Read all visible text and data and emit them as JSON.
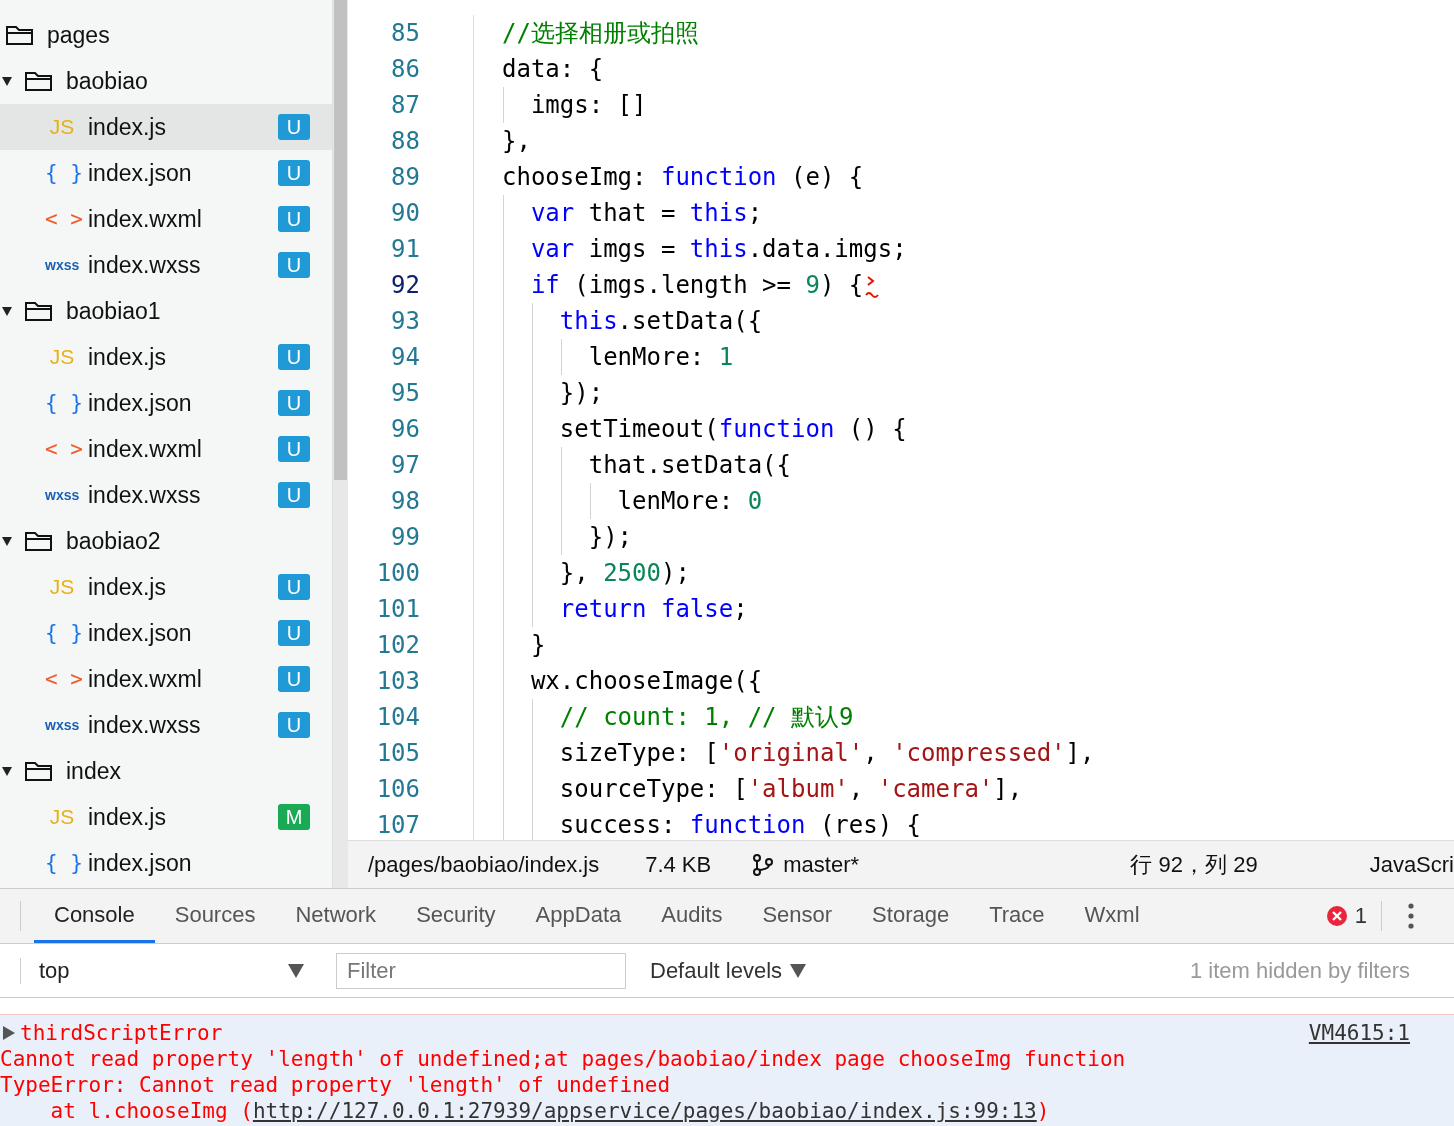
{
  "sidebar": {
    "tree": [
      {
        "name": "pages",
        "kind": "folder",
        "children": [
          {
            "name": "baobiao",
            "kind": "folder",
            "expanded": true,
            "children": [
              {
                "name": "index.js",
                "kind": "js",
                "icon": "JS",
                "badge": "U",
                "color": "#1f9ad6",
                "selected": true
              },
              {
                "name": "index.json",
                "kind": "json",
                "icon": "{ }",
                "badge": "U",
                "color": "#1f9ad6",
                "selected": false
              },
              {
                "name": "index.wxml",
                "kind": "wxml",
                "icon": "< >",
                "badge": "U",
                "color": "#1f9ad6",
                "selected": false
              },
              {
                "name": "index.wxss",
                "kind": "wxss",
                "icon": "wxss",
                "badge": "U",
                "color": "#1f9ad6",
                "selected": false
              }
            ]
          },
          {
            "name": "baobiao1",
            "kind": "folder",
            "expanded": true,
            "children": [
              {
                "name": "index.js",
                "kind": "js",
                "icon": "JS",
                "badge": "U",
                "color": "#1f9ad6",
                "selected": false
              },
              {
                "name": "index.json",
                "kind": "json",
                "icon": "{ }",
                "badge": "U",
                "color": "#1f9ad6",
                "selected": false
              },
              {
                "name": "index.wxml",
                "kind": "wxml",
                "icon": "< >",
                "badge": "U",
                "color": "#1f9ad6",
                "selected": false
              },
              {
                "name": "index.wxss",
                "kind": "wxss",
                "icon": "wxss",
                "badge": "U",
                "color": "#1f9ad6",
                "selected": false
              }
            ]
          },
          {
            "name": "baobiao2",
            "kind": "folder",
            "expanded": true,
            "children": [
              {
                "name": "index.js",
                "kind": "js",
                "icon": "JS",
                "badge": "U",
                "color": "#1f9ad6",
                "selected": false
              },
              {
                "name": "index.json",
                "kind": "json",
                "icon": "{ }",
                "badge": "U",
                "color": "#1f9ad6",
                "selected": false
              },
              {
                "name": "index.wxml",
                "kind": "wxml",
                "icon": "< >",
                "badge": "U",
                "color": "#1f9ad6",
                "selected": false
              },
              {
                "name": "index.wxss",
                "kind": "wxss",
                "icon": "wxss",
                "badge": "U",
                "color": "#1f9ad6",
                "selected": false
              }
            ]
          },
          {
            "name": "index",
            "kind": "folder",
            "expanded": true,
            "children": [
              {
                "name": "index.js",
                "kind": "js",
                "icon": "JS",
                "badge": "M",
                "color": "#1aaa55",
                "selected": false
              },
              {
                "name": "index.json",
                "kind": "json",
                "icon": "{ }",
                "selected": false
              }
            ]
          }
        ]
      }
    ]
  },
  "editor": {
    "lines": [
      {
        "number": "85",
        "current": false,
        "tokens": [
          {
            "t": "//选择相册或拍照",
            "kind": "comment"
          }
        ]
      },
      {
        "number": "86",
        "current": false,
        "tokens": [
          {
            "t": "data: {",
            "kind": "plain"
          }
        ]
      },
      {
        "number": "87",
        "current": false,
        "tokens": [
          {
            "t": "  imgs: []",
            "kind": "plain"
          }
        ]
      },
      {
        "number": "88",
        "current": false,
        "tokens": [
          {
            "t": "},",
            "kind": "plain"
          }
        ]
      },
      {
        "number": "89",
        "current": false,
        "tokens": [
          {
            "t": "chooseImg: ",
            "kind": "plain"
          },
          {
            "t": "function",
            "kind": "keyword"
          },
          {
            "t": " (e) {",
            "kind": "plain"
          }
        ]
      },
      {
        "number": "90",
        "current": false,
        "tokens": [
          {
            "t": "  var",
            "kind": "keyword"
          },
          {
            "t": " that = ",
            "kind": "plain"
          },
          {
            "t": "this",
            "kind": "keyword"
          },
          {
            "t": ";",
            "kind": "plain"
          }
        ]
      },
      {
        "number": "91",
        "current": false,
        "tokens": [
          {
            "t": "  var",
            "kind": "keyword"
          },
          {
            "t": " imgs = ",
            "kind": "plain"
          },
          {
            "t": "this",
            "kind": "keyword"
          },
          {
            "t": ".data.imgs;",
            "kind": "plain"
          }
        ]
      },
      {
        "number": "92",
        "current": true,
        "squiggle": true,
        "tokens": [
          {
            "t": "  if",
            "kind": "keyword"
          },
          {
            "t": " (imgs.length >= ",
            "kind": "plain"
          },
          {
            "t": "9",
            "kind": "number"
          },
          {
            "t": ") {",
            "kind": "plain"
          }
        ]
      },
      {
        "number": "93",
        "current": false,
        "tokens": [
          {
            "t": "    this",
            "kind": "keyword"
          },
          {
            "t": ".setData({",
            "kind": "plain"
          }
        ]
      },
      {
        "number": "94",
        "current": false,
        "tokens": [
          {
            "t": "      lenMore: ",
            "kind": "plain"
          },
          {
            "t": "1",
            "kind": "number"
          }
        ]
      },
      {
        "number": "95",
        "current": false,
        "tokens": [
          {
            "t": "    });",
            "kind": "plain"
          }
        ]
      },
      {
        "number": "96",
        "current": false,
        "tokens": [
          {
            "t": "    setTimeout(",
            "kind": "plain"
          },
          {
            "t": "function",
            "kind": "keyword"
          },
          {
            "t": " () {",
            "kind": "plain"
          }
        ]
      },
      {
        "number": "97",
        "current": false,
        "tokens": [
          {
            "t": "      that.setData({",
            "kind": "plain"
          }
        ]
      },
      {
        "number": "98",
        "current": false,
        "tokens": [
          {
            "t": "        lenMore: ",
            "kind": "plain"
          },
          {
            "t": "0",
            "kind": "number"
          }
        ]
      },
      {
        "number": "99",
        "current": false,
        "tokens": [
          {
            "t": "      });",
            "kind": "plain"
          }
        ]
      },
      {
        "number": "100",
        "current": false,
        "tokens": [
          {
            "t": "    }, ",
            "kind": "plain"
          },
          {
            "t": "2500",
            "kind": "number"
          },
          {
            "t": ");",
            "kind": "plain"
          }
        ]
      },
      {
        "number": "101",
        "current": false,
        "tokens": [
          {
            "t": "    return false",
            "kind": "keyword"
          },
          {
            "t": ";",
            "kind": "plain"
          }
        ]
      },
      {
        "number": "102",
        "current": false,
        "tokens": [
          {
            "t": "  }",
            "kind": "plain"
          }
        ]
      },
      {
        "number": "103",
        "current": false,
        "tokens": [
          {
            "t": "  wx.chooseImage({",
            "kind": "plain"
          }
        ]
      },
      {
        "number": "104",
        "current": false,
        "tokens": [
          {
            "t": "    // count: 1, // 默认9",
            "kind": "comment"
          }
        ]
      },
      {
        "number": "105",
        "current": false,
        "tokens": [
          {
            "t": "    sizeType: [",
            "kind": "plain"
          },
          {
            "t": "'original'",
            "kind": "string"
          },
          {
            "t": ", ",
            "kind": "plain"
          },
          {
            "t": "'compressed'",
            "kind": "string"
          },
          {
            "t": "],",
            "kind": "plain"
          }
        ]
      },
      {
        "number": "106",
        "current": false,
        "tokens": [
          {
            "t": "    sourceType: [",
            "kind": "plain"
          },
          {
            "t": "'album'",
            "kind": "string"
          },
          {
            "t": ", ",
            "kind": "plain"
          },
          {
            "t": "'camera'",
            "kind": "string"
          },
          {
            "t": "],",
            "kind": "plain"
          }
        ]
      },
      {
        "number": "107",
        "current": false,
        "tokens": [
          {
            "t": "    success: ",
            "kind": "plain"
          },
          {
            "t": "function",
            "kind": "keyword"
          },
          {
            "t": " (res) {",
            "kind": "plain"
          }
        ]
      }
    ]
  },
  "status_bar": {
    "path": "/pages/baobiao/index.js",
    "size": "7.4 KB",
    "branch": "master*",
    "position": "行 92，列 29",
    "language": "JavaScri"
  },
  "devtools": {
    "tabs": [
      {
        "label": "Console",
        "selected": true
      },
      {
        "label": "Sources",
        "selected": false
      },
      {
        "label": "Network",
        "selected": false
      },
      {
        "label": "Security",
        "selected": false
      },
      {
        "label": "AppData",
        "selected": false
      },
      {
        "label": "Audits",
        "selected": false
      },
      {
        "label": "Sensor",
        "selected": false
      },
      {
        "label": "Storage",
        "selected": false
      },
      {
        "label": "Trace",
        "selected": false
      },
      {
        "label": "Wxml",
        "selected": false
      }
    ],
    "error_count": "1",
    "context": "top",
    "filter": {
      "placeholder": "Filter"
    },
    "levels": "Default levels",
    "hidden_note": "1 item hidden by filters",
    "messages": [
      {
        "kind": "error",
        "expanded": false,
        "title": "thirdScriptError",
        "source": "VM4615:1",
        "lines": [
          {
            "text": "Cannot read property 'length' of undefined;at pages/baobiao/index page chooseImg function"
          },
          {
            "text": "TypeError: Cannot read property 'length' of undefined"
          },
          {
            "text": "    at l.chooseImg (",
            "link": "http://127.0.0.1:27939/appservice/pages/baobiao/index.js:99:13",
            "suffix": ")"
          }
        ]
      }
    ]
  }
}
